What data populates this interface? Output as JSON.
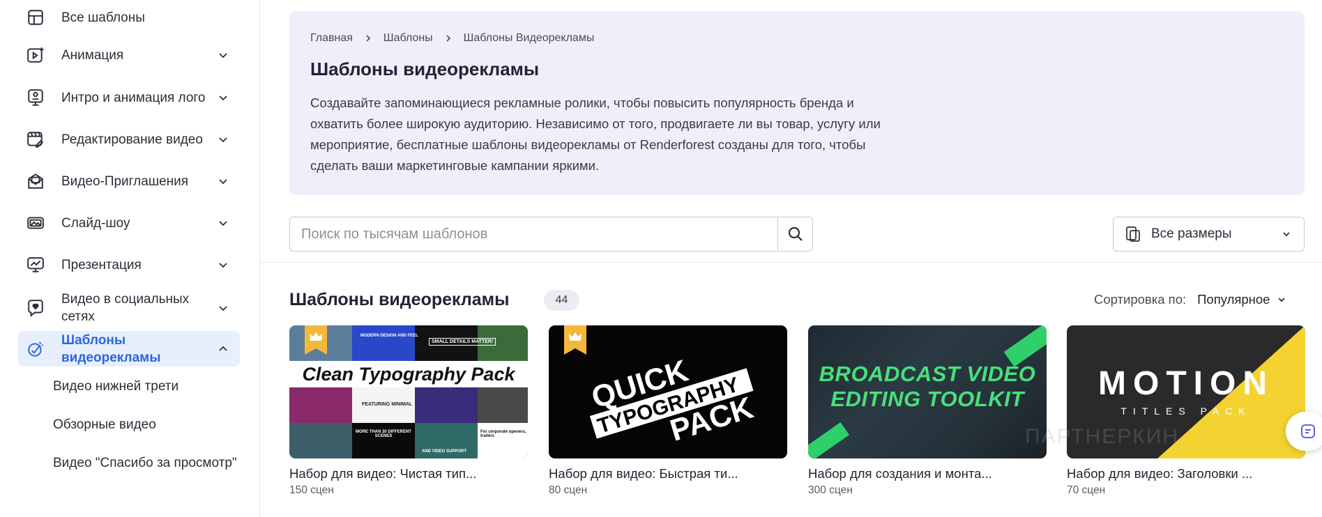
{
  "sidebar": {
    "items": [
      {
        "label": "Все шаблоны",
        "icon": "grid-icon"
      },
      {
        "label": "Анимация",
        "icon": "animation-icon"
      },
      {
        "label": "Интро и анимация лого",
        "icon": "logo-intro-icon"
      },
      {
        "label": "Редактирование видео",
        "icon": "video-edit-icon"
      },
      {
        "label": "Видео-Приглашения",
        "icon": "invitation-icon"
      },
      {
        "label": "Слайд-шоу",
        "icon": "slideshow-icon"
      },
      {
        "label": "Презентация",
        "icon": "presentation-icon"
      },
      {
        "label": "Видео в социальных сетях",
        "icon": "social-video-icon"
      },
      {
        "label": "Шаблоны видеорекламы",
        "icon": "ad-video-icon"
      }
    ],
    "sub_items": [
      "Видео нижней трети",
      "Обзорные видео",
      "Видео \"Спасибо за просмотр\""
    ]
  },
  "hero": {
    "breadcrumbs": [
      "Главная",
      "Шаблоны",
      "Шаблоны Видеорекламы"
    ],
    "title": "Шаблоны видеорекламы",
    "description": "Создавайте запоминающиеся рекламные ролики, чтобы повысить популярность бренда и охватить более широкую аудиторию. Независимо от того, продвигаете ли вы товар, услугу или мероприятие, бесплатные шаблоны видеорекламы от Renderforest созданы для того, чтобы сделать ваши маркетинговые кампании яркими."
  },
  "search": {
    "placeholder": "Поиск по тысячам шаблонов"
  },
  "size_filter": {
    "label": "Все размеры"
  },
  "section": {
    "title": "Шаблоны видеорекламы",
    "count": "44",
    "sort_label": "Сортировка по:",
    "sort_value": "Популярное"
  },
  "cards": [
    {
      "title": "Набор для видео: Чистая тип...",
      "meta": "150 сцен",
      "thumb_text": "Clean Typography Pack",
      "premium": true
    },
    {
      "title": "Набор для видео: Быстрая ти...",
      "meta": "80 сцен",
      "thumb_lines": [
        "QUICK",
        "TYPOGRAPHY",
        "PACK"
      ],
      "premium": true
    },
    {
      "title": "Набор для создания и монта...",
      "meta": "300 сцен",
      "thumb_lines": [
        "BROADCAST VIDEO",
        "EDITING TOOLKIT"
      ],
      "premium": false
    },
    {
      "title": "Набор для видео: Заголовки ...",
      "meta": "70 сцен",
      "thumb_main": "MOTION",
      "thumb_sub": "TITLES PACK",
      "premium": false
    }
  ],
  "tile_texts": {
    "t1": [
      "MODERN DESIGN AND FEEL",
      "SMALL DETAILS MATTER!",
      "FEATURING MINIMAL",
      "MORE THAN 30 DIFFERENT SCENES",
      "For corporate openers, trailers",
      "AND VIDEO SUPPORT"
    ]
  },
  "watermark": "ПАРТНЕРКИН",
  "colors": {
    "accent": "#2a66e0",
    "hero_bg": "#f2edfb",
    "premium_badge": "#f4b73b"
  }
}
